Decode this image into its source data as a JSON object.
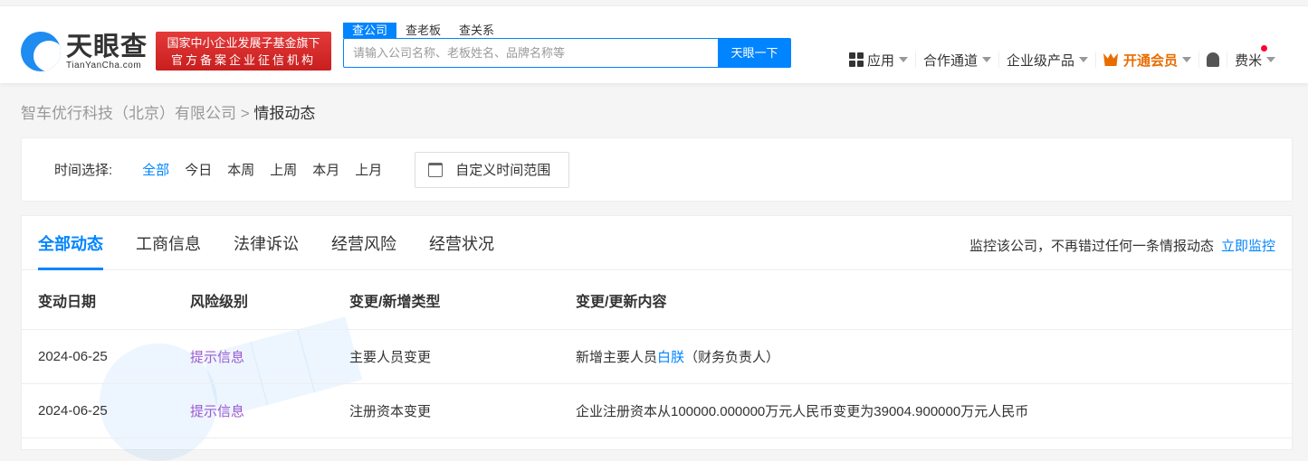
{
  "header": {
    "logo_cn": "天眼查",
    "logo_en": "TianYanCha.com",
    "badge": [
      "国家中小企业发展子基金旗下",
      "官方备案企业征信机构"
    ],
    "search_tabs": [
      "查公司",
      "查老板",
      "查关系"
    ],
    "search_placeholder": "请输入公司名称、老板姓名、品牌名称等",
    "search_button": "天眼一下",
    "nav": {
      "apps": "应用",
      "channel": "合作通道",
      "enterprise": "企业级产品",
      "vip": "开通会员",
      "user": "费米"
    }
  },
  "breadcrumb": {
    "company": "智车优行科技（北京）有限公司",
    "sep": ">",
    "current": "情报动态"
  },
  "time_filter": {
    "label": "时间选择:",
    "options": [
      "全部",
      "今日",
      "本周",
      "上周",
      "本月",
      "上月"
    ],
    "custom": "自定义时间范围"
  },
  "tabs": [
    "全部动态",
    "工商信息",
    "法律诉讼",
    "经营风险",
    "经营状况"
  ],
  "monitor": {
    "text": "监控该公司，不再错过任何一条情报动态",
    "link": "立即监控"
  },
  "table": {
    "headers": [
      "变动日期",
      "风险级别",
      "变更/新增类型",
      "变更/更新内容"
    ],
    "rows": [
      {
        "date": "2024-06-25",
        "risk": "提示信息",
        "type": "主要人员变更",
        "content_pre": "新增主要人员",
        "content_link": "白朕",
        "content_post": "（财务负责人）"
      },
      {
        "date": "2024-06-25",
        "risk": "提示信息",
        "type": "注册资本变更",
        "content_pre": "企业注册资本从100000.000000万元人民币变更为39004.900000万元人民币",
        "content_link": "",
        "content_post": ""
      }
    ]
  },
  "colors": {
    "accent": "#0084ff",
    "vip": "#e96c00",
    "risk": "#9b59d0"
  }
}
